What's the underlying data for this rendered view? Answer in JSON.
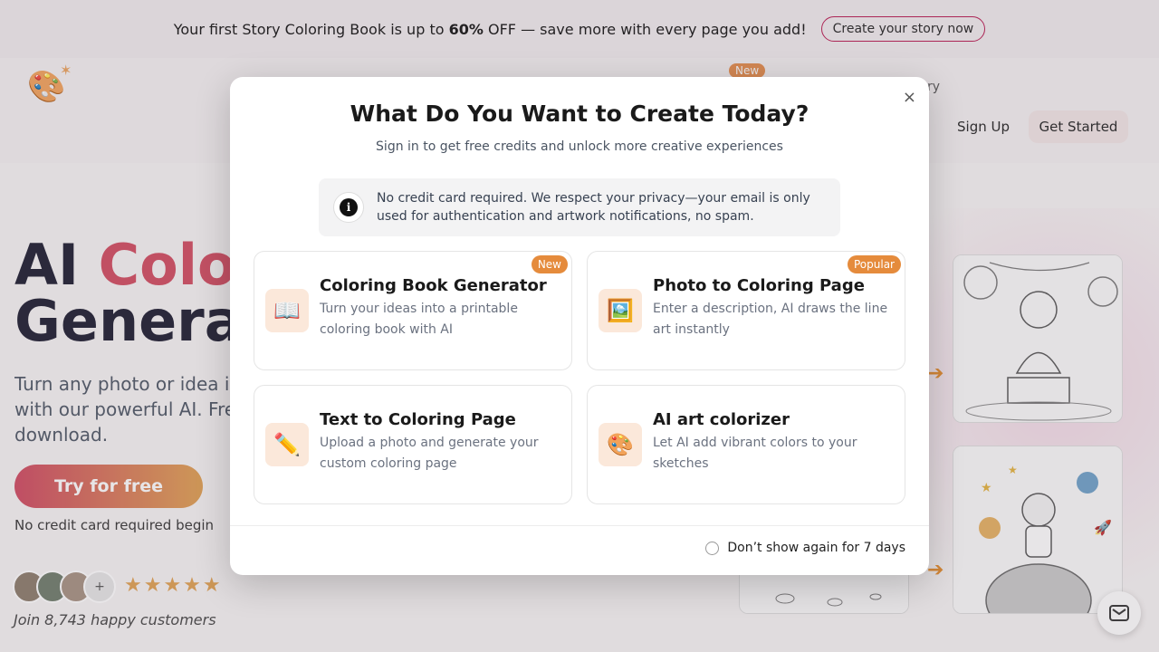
{
  "promo": {
    "text_before": "Your first Story Coloring Book is up to ",
    "highlight": "60%",
    "text_after": " OFF — save more with every page you add!",
    "cta": "Create your story now"
  },
  "header": {
    "nav_new_badge": "New",
    "nav_partial": "ry",
    "sign_up": "Sign Up",
    "get_started": "Get Started"
  },
  "hero": {
    "title_word1": "AI ",
    "title_accent": "Colo",
    "title_line2": "Genera",
    "desc_lines": [
      "Turn any photo or idea i",
      "with our powerful AI. Fre",
      "download."
    ],
    "try_button": "Try for free",
    "no_credit": "No credit card required begin",
    "avatar_plus": "+",
    "stars": "★★★★★",
    "join": "Join 8,743 happy customers"
  },
  "modal": {
    "close": "×",
    "title": "What Do You Want to Create Today?",
    "subtitle": "Sign in to get free credits and unlock more creative experiences",
    "notice": "No credit card required. We respect your privacy—your email is only used for authentication and artwork notifications, no spam.",
    "cards": [
      {
        "title": "Coloring Book Generator",
        "desc": "Turn your ideas into a printable coloring book with AI",
        "badge": "New",
        "icon": "📖"
      },
      {
        "title": "Photo to Coloring Page",
        "desc": "Enter a description, AI draws the line art instantly",
        "badge": "Popular",
        "icon": "🖼️"
      },
      {
        "title": "Text to Coloring Page",
        "desc": "Upload a photo and generate your custom coloring page",
        "badge": "",
        "icon": "✏️"
      },
      {
        "title": "AI art colorizer",
        "desc": "Let AI add vibrant colors to your sketches",
        "badge": "",
        "icon": "🎨"
      }
    ],
    "dont_show": "Don’t show again for 7 days"
  },
  "colors": {
    "accent": "#d14a5e",
    "badge": "#e58b3c",
    "icon_bg": "#fbe8da"
  }
}
